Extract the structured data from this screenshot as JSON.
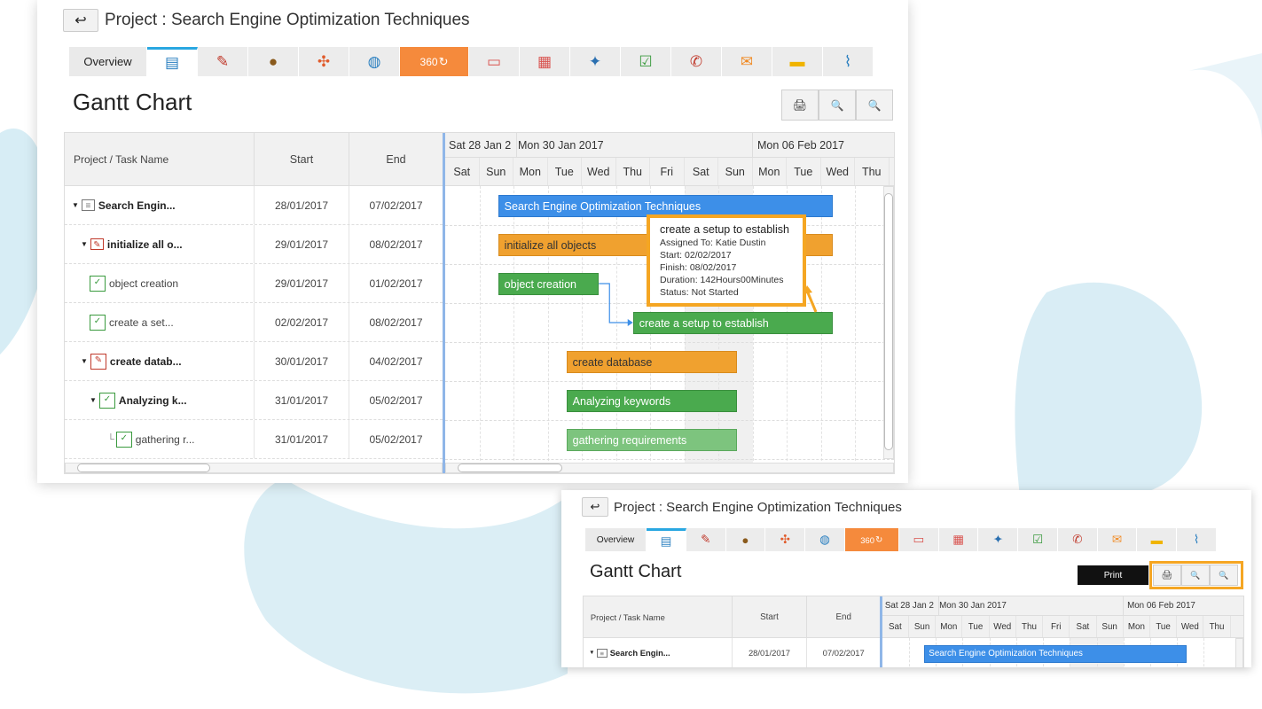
{
  "project_title": "Project : Search Engine Optimization Techniques",
  "gantt_title": "Gantt Chart",
  "tabs": [
    {
      "label": "Overview",
      "icon": "overview"
    },
    {
      "label": "",
      "icon": "gantt-icon",
      "active": true
    },
    {
      "label": "",
      "icon": "task-edit-icon"
    },
    {
      "label": "",
      "icon": "money-bag-icon"
    },
    {
      "label": "",
      "icon": "team-icon"
    },
    {
      "label": "",
      "icon": "globe-icon"
    },
    {
      "label": "360",
      "icon": "360-icon",
      "orange": true
    },
    {
      "label": "",
      "icon": "invoice-icon"
    },
    {
      "label": "",
      "icon": "calendar-icon"
    },
    {
      "label": "",
      "icon": "pin-icon"
    },
    {
      "label": "",
      "icon": "checklist-icon"
    },
    {
      "label": "",
      "icon": "phone-icon"
    },
    {
      "label": "",
      "icon": "email-icon"
    },
    {
      "label": "",
      "icon": "note-icon"
    },
    {
      "label": "",
      "icon": "attachment-icon"
    }
  ],
  "columns": {
    "name": "Project / Task Name",
    "start": "Start",
    "end": "End"
  },
  "tasks": [
    {
      "name": "Search Engin...",
      "start": "28/01/2017",
      "end": "07/02/2017",
      "bold": true
    },
    {
      "name": "initialize all o...",
      "start": "29/01/2017",
      "end": "08/02/2017",
      "bold": true
    },
    {
      "name": "object creation",
      "start": "29/01/2017",
      "end": "01/02/2017",
      "bold": false
    },
    {
      "name": "create a set...",
      "start": "02/02/2017",
      "end": "08/02/2017",
      "bold": false
    },
    {
      "name": "create datab...",
      "start": "30/01/2017",
      "end": "04/02/2017",
      "bold": true
    },
    {
      "name": "Analyzing k...",
      "start": "31/01/2017",
      "end": "05/02/2017",
      "bold": true
    },
    {
      "name": "gathering r...",
      "start": "31/01/2017",
      "end": "05/02/2017",
      "bold": false
    }
  ],
  "timeline": {
    "weeks": [
      "Sat 28 Jan 2",
      "Mon 30 Jan 2017",
      "Mon 06 Feb 2017"
    ],
    "days": [
      "Sat",
      "Sun",
      "Mon",
      "Tue",
      "Wed",
      "Thu",
      "Fri",
      "Sat",
      "Sun",
      "Mon",
      "Tue",
      "Wed",
      "Thu"
    ]
  },
  "bars": [
    {
      "label": "Search Engine Optimization Techniques",
      "color": "#3d8fe8"
    },
    {
      "label": "initialize all objects",
      "color": "#f0a12f"
    },
    {
      "label": "object creation",
      "color": "#4aaa4e"
    },
    {
      "label": "create a setup to establish",
      "color": "#4aaa4e"
    },
    {
      "label": "create database",
      "color": "#f0a12f"
    },
    {
      "label": "Analyzing keywords",
      "color": "#4aaa4e"
    },
    {
      "label": "gathering requirements",
      "color": "#7dc47e"
    }
  ],
  "tooltip": {
    "title": "create a setup to establish",
    "assigned": "Assigned To: Katie Dustin",
    "start": "Start: 02/02/2017",
    "finish": "Finish: 08/02/2017",
    "duration": "Duration: 142Hours00Minutes",
    "status": "Status: Not Started"
  },
  "print_tooltip": "Print",
  "accent_color": "#f5a623"
}
